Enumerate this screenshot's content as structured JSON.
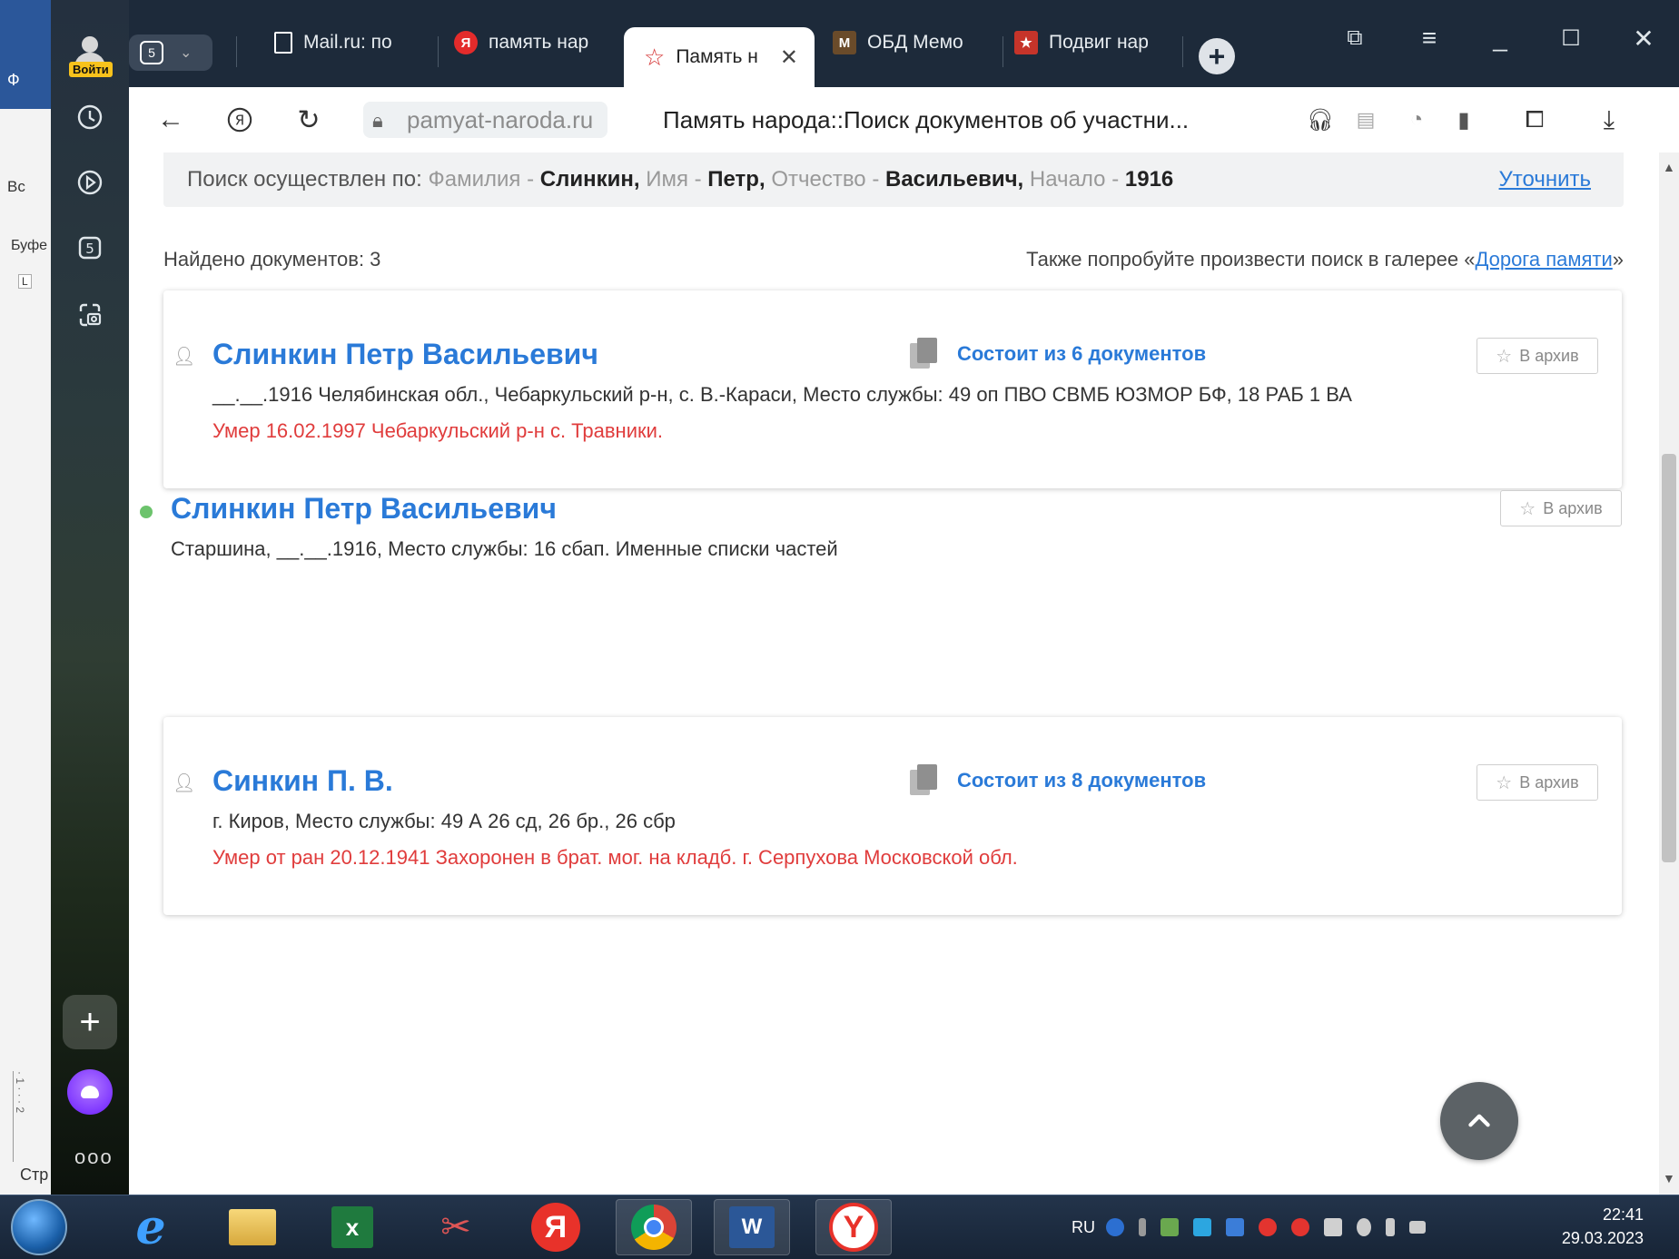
{
  "background_app": {
    "fragments": [
      "Ф",
      "Вс",
      "Буфе",
      "L",
      "Стр"
    ],
    "ruler": "· 1 · · · 2"
  },
  "sidebar": {
    "login_label": "Войти",
    "more": "ooo"
  },
  "tabs": [
    {
      "label": "Mail.ru: по",
      "icon": "document-icon"
    },
    {
      "label": "память нар",
      "icon": "yandex-icon"
    },
    {
      "label": "Память н",
      "icon": "star-icon",
      "active": true
    },
    {
      "label": "ОБД Мемо",
      "icon": "obd-icon"
    },
    {
      "label": "Подвиг нар",
      "icon": "podvig-icon"
    }
  ],
  "tabs_group_badge": "5",
  "address_bar": {
    "domain": "pamyat-naroda.ru",
    "page_title": "Память народа::Поиск документов об участни..."
  },
  "search_summary": {
    "prefix": "Поиск осуществлен по:",
    "surname_label": "Фамилия -",
    "surname": "Слинкин,",
    "name_label": "Имя -",
    "name": "Петр,",
    "patronymic_label": "Отчество -",
    "patronymic": "Васильевич,",
    "start_label": "Начало -",
    "start": "1916",
    "refine": "Уточнить"
  },
  "found_count": "Найдено документов: 3",
  "gallery_hint": {
    "text": "Также попробуйте произвести поиск в галерее «",
    "link": "Дорога памяти",
    "suffix": "»"
  },
  "archive_label": "В архив",
  "results": [
    {
      "name": "Слинкин Петр Васильевич",
      "docs": "Состоит из 6 документов",
      "info": "__.__.1916 Челябинская обл., Чебаркульский р-н, с. В.-Караси, Место службы: 49 оп ПВО СВМБ ЮЗМОР БФ, 18 РАБ 1 ВА",
      "death": "Умер 16.02.1997 Чебаркульский р-н с. Травники."
    },
    {
      "name": "Слинкин Петр Васильевич",
      "info": "Старшина, __.__.1916, Место службы: 16 сбап. Именные списки частей"
    },
    {
      "name": "Синкин П. В.",
      "docs": "Состоит из 8 документов",
      "info": "г. Киров, Место службы: 49 А 26 сд, 26 бр., 26 сбр",
      "death": "Умер от ран 20.12.1941 Захоронен в брат. мог. на кладб. г. Серпухова Московской обл."
    }
  ],
  "taskbar": {
    "lang": "RU",
    "time": "22:41",
    "date": "29.03.2023"
  }
}
